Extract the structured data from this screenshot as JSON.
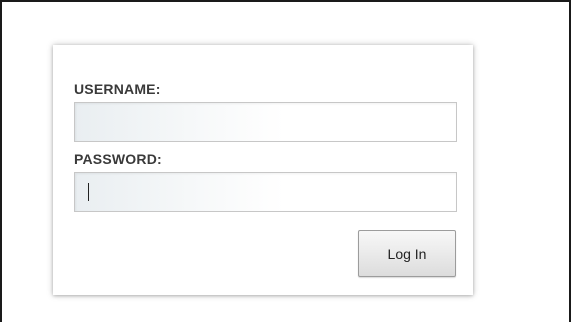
{
  "login_form": {
    "username_label": "USERNAME:",
    "username_value": "",
    "password_label": "PASSWORD:",
    "password_value": "",
    "login_button_label": "Log In"
  },
  "colors": {
    "label_text": "#3a3a3a",
    "input_border": "#c7c7c7",
    "button_border": "#9c9c9c",
    "frame_border": "#1a1a1a"
  }
}
